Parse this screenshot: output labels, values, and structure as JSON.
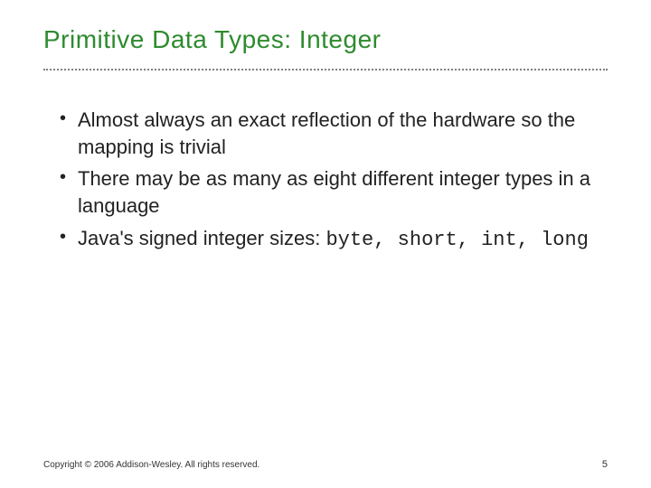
{
  "title": "Primitive Data Types: Integer",
  "bullets": [
    {
      "text": "Almost always an exact reflection of the hardware so the mapping is trivial"
    },
    {
      "text": "There may be as many as eight different integer types in a language"
    },
    {
      "prefix": "Java's signed integer sizes: ",
      "code": "byte, short, int, long"
    }
  ],
  "footer": {
    "copyright": "Copyright © 2006 Addison-Wesley. All rights reserved.",
    "page": "5"
  }
}
